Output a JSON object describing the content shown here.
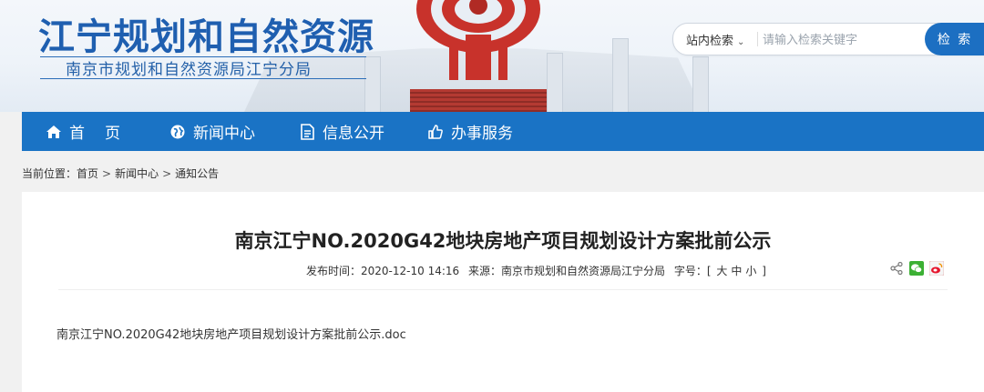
{
  "header": {
    "site_title": "江宁规划和自然资源",
    "site_subtitle": "南京市规划和自然资源局江宁分局"
  },
  "search": {
    "scope_label": "站内检索",
    "scope_icon": "chevron-down-icon",
    "placeholder": "请输入检索关键字",
    "button_label": "检 索"
  },
  "nav": {
    "items": [
      {
        "label": "首页",
        "icon": "home-icon"
      },
      {
        "label": "新闻中心",
        "icon": "globe-icon"
      },
      {
        "label": "信息公开",
        "icon": "document-icon"
      },
      {
        "label": "办事服务",
        "icon": "thumbs-up-icon"
      }
    ]
  },
  "breadcrumb": {
    "prefix": "当前位置：",
    "items": [
      "首页",
      "新闻中心",
      "通知公告"
    ],
    "separator": ">"
  },
  "article": {
    "title": "南京江宁NO.2020G42地块房地产项目规划设计方案批前公示",
    "publish_label": "发布时间：",
    "publish_time": "2020-12-10 14:16",
    "source_label": "来源：",
    "source": "南京市规划和自然资源局江宁分局",
    "fontsize_label": "字号：",
    "fontsize_open": "[",
    "fontsize_large": "大",
    "fontsize_medium": "中",
    "fontsize_small": "小",
    "fontsize_close": "]",
    "attachment": "南京江宁NO.2020G42地块房地产项目规划设计方案批前公示.doc"
  },
  "share": {
    "icons": [
      "share-icon",
      "wechat-icon",
      "weibo-icon"
    ]
  },
  "colors": {
    "nav_bg": "#1a73c5",
    "title_blue": "#1f5fb0",
    "search_button": "#1c6fc2"
  }
}
